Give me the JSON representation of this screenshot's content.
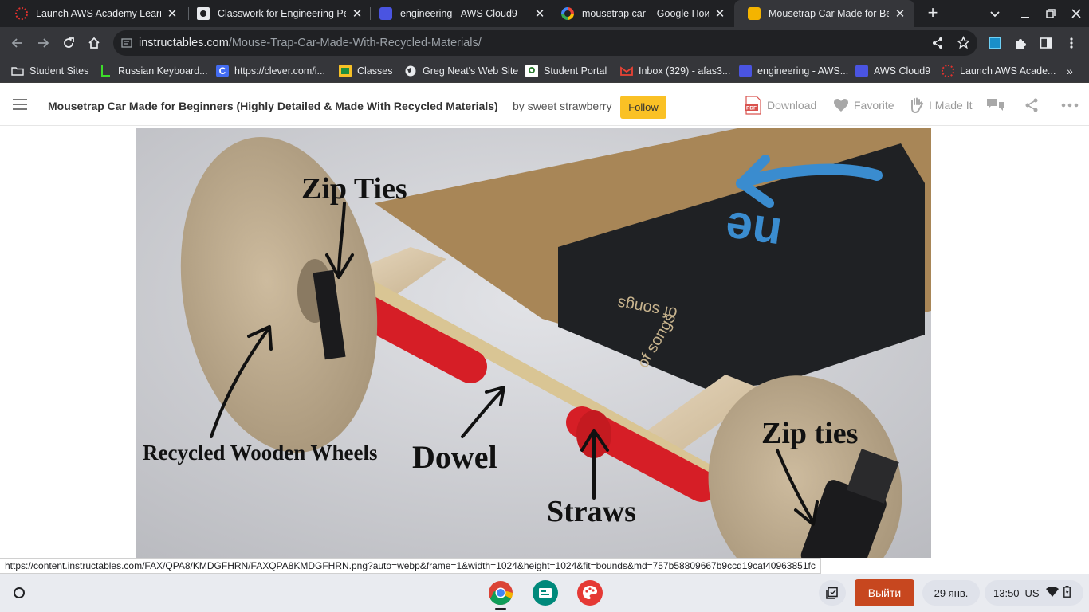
{
  "tabs": [
    {
      "title": "Launch AWS Academy Learne",
      "favicon": "aws-academy-icon",
      "active": false
    },
    {
      "title": "Classwork for Engineering Pe",
      "favicon": "classroom-icon",
      "active": false
    },
    {
      "title": "engineering - AWS Cloud9",
      "favicon": "cloud9-icon",
      "active": false
    },
    {
      "title": "mousetrap car – Google Поис",
      "favicon": "google-icon",
      "active": false
    },
    {
      "title": "Mousetrap Car Made for Begir",
      "favicon": "instructables-icon",
      "active": true
    }
  ],
  "address_bar": {
    "host": "instructables.com",
    "path": "/Mouse-Trap-Car-Made-With-Recycled-Materials/"
  },
  "bookmarks": [
    {
      "label": "Student Sites",
      "icon": "folder-icon"
    },
    {
      "label": "Russian Keyboard...",
      "icon": "keyboard-icon"
    },
    {
      "label": "https://clever.com/i...",
      "icon": "clever-icon"
    },
    {
      "label": "Classes",
      "icon": "classroom-icon"
    },
    {
      "label": "Greg Neat's Web Site",
      "icon": "globe-icon"
    },
    {
      "label": "Student Portal",
      "icon": "portal-icon"
    },
    {
      "label": "Inbox (329) - afas3...",
      "icon": "gmail-icon"
    },
    {
      "label": "engineering - AWS...",
      "icon": "cloud9-icon"
    },
    {
      "label": "AWS Cloud9",
      "icon": "cloud9-icon"
    },
    {
      "label": "Launch AWS Acade...",
      "icon": "aws-academy-icon"
    }
  ],
  "site_header": {
    "title": "Mousetrap Car Made for Beginners (Highly Detailed & Made With Recycled Materials)",
    "by": "by",
    "author": "sweet strawberry",
    "follow_label": "Follow",
    "actions": {
      "download": "Download",
      "pdf_badge": "PDF",
      "favorite": "Favorite",
      "i_made_it": "I Made It"
    }
  },
  "hero_image": {
    "labels": {
      "zip_ties_top": "Zip Ties",
      "wheels": "Recycled Wooden Wheels",
      "dowel": "Dowel",
      "straws": "Straws",
      "zip_ties_bottom": "Zip ties"
    },
    "cardboard_text": {
      "big": "ne",
      "small1": "of songs",
      "small2": "of songs"
    }
  },
  "status_link": "https://content.instructables.com/FAX/QPA8/KMDGFHRN/FAXQPA8KMDGFHRN.png?auto=webp&frame=1&width=1024&height=1024&fit=bounds&md=757b58809667b9ccd19caf40963851fc",
  "shelf": {
    "signout_label": "Выйти",
    "date": "29 янв.",
    "time": "13:50",
    "locale": "US"
  },
  "colors": {
    "follow": "#fac125",
    "signout": "#c7471f",
    "chrome_dark": "#202124",
    "toolbar": "#35363a"
  }
}
